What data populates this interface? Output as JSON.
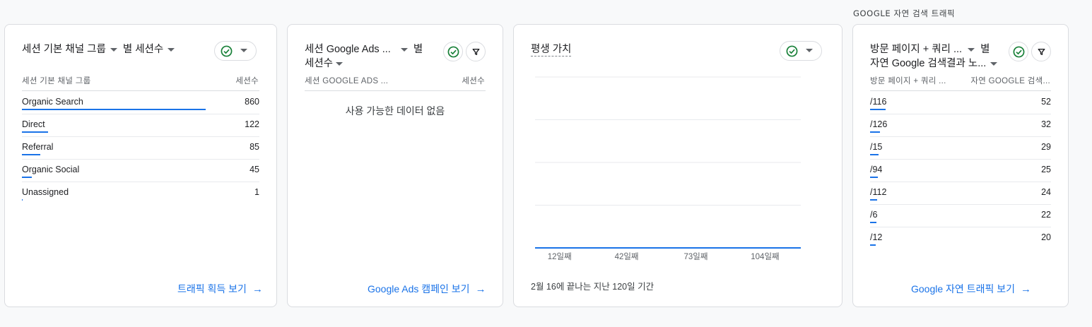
{
  "section_label": "GOOGLE 자연 검색 트래픽",
  "card1": {
    "title_dim": "세션 기본 채널 그룹",
    "title_metric": "별 세션수",
    "col_dim": "세션 기본 채널 그룹",
    "col_metric": "세션수",
    "rows": [
      {
        "label": "Organic Search",
        "value": "860",
        "fraction": 1.0
      },
      {
        "label": "Direct",
        "value": "122",
        "fraction": 0.142
      },
      {
        "label": "Referral",
        "value": "85",
        "fraction": 0.099
      },
      {
        "label": "Organic Social",
        "value": "45",
        "fraction": 0.052
      },
      {
        "label": "Unassigned",
        "value": "1",
        "fraction": 0.002
      }
    ],
    "link": "트래픽 획득 보기"
  },
  "card2": {
    "title_line1": "세션 Google Ads ...",
    "title_suffix": "별",
    "title_line2": "세션수",
    "col_dim": "세션 GOOGLE ADS ...",
    "col_metric": "세션수",
    "empty": "사용 가능한 데이터 없음",
    "link": "Google Ads 캠페인 보기"
  },
  "card3": {
    "title": "평생 가치",
    "footnote": "2월 16에 끝나는 지난 120일 기간",
    "chart_data": {
      "type": "line",
      "x": [
        1,
        12,
        42,
        73,
        104,
        120
      ],
      "values": [
        0,
        0,
        0,
        0,
        0,
        0
      ],
      "tick_labels": [
        "12일째",
        "42일째",
        "73일째",
        "104일째"
      ],
      "tick_values": [
        12,
        42,
        73,
        104
      ],
      "xlim": [
        1,
        120
      ],
      "gridlines": 4,
      "grid": true
    }
  },
  "card4": {
    "title_line1": "방문 페이지 + 쿼리 ...",
    "title_suffix": "별",
    "title_line2": "자연 Google 검색결과 노...",
    "col_dim": "방문 페이지 + 쿼리 ...",
    "col_metric": "자연 GOOGLE 검색...",
    "rows": [
      {
        "label": "/116",
        "value": "52",
        "fraction": 1.0
      },
      {
        "label": "/126",
        "value": "32",
        "fraction": 0.615
      },
      {
        "label": "/15",
        "value": "29",
        "fraction": 0.558
      },
      {
        "label": "/94",
        "value": "25",
        "fraction": 0.481
      },
      {
        "label": "/112",
        "value": "24",
        "fraction": 0.462
      },
      {
        "label": "/6",
        "value": "22",
        "fraction": 0.423
      },
      {
        "label": "/12",
        "value": "20",
        "fraction": 0.385
      }
    ],
    "link": "Google 자연 트래픽 보기"
  },
  "colors": {
    "accent": "#1a73e8",
    "check": "#188038",
    "border": "#dadce0"
  },
  "icons": {
    "check": "check-circle-icon",
    "filter": "filter-icon",
    "arrow": "arrow-right-icon",
    "dropdown": "caret-down-icon"
  }
}
